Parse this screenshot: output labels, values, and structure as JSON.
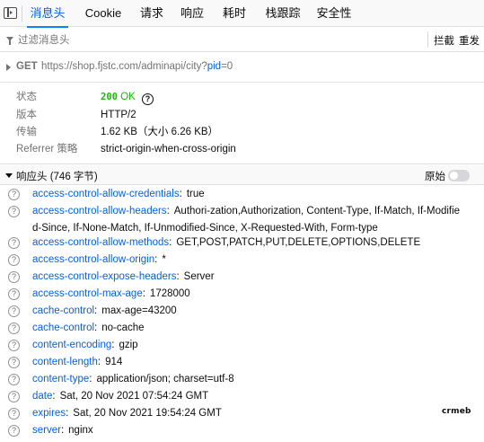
{
  "tabs": [
    {
      "label": "消息头",
      "active": true
    },
    {
      "label": "Cookie",
      "active": false
    },
    {
      "label": "请求",
      "active": false
    },
    {
      "label": "响应",
      "active": false
    },
    {
      "label": "耗时",
      "active": false
    },
    {
      "label": "栈跟踪",
      "active": false
    },
    {
      "label": "安全性",
      "active": false
    }
  ],
  "filter": {
    "placeholder": "过滤消息头",
    "block_label": "拦截",
    "resend_label": "重发"
  },
  "request": {
    "method": "GET",
    "url_base": "https://shop.fjstc.com/adminapi/city?",
    "url_param_key": "pid",
    "url_param_eq": "=0"
  },
  "summary": {
    "status_label": "状态",
    "status_code": "200",
    "status_text": "OK",
    "version_label": "版本",
    "version_value": "HTTP/2",
    "transfer_label": "传输",
    "transfer_value": "1.62 KB（大小 6.26 KB）",
    "referrer_label": "Referrer 策略",
    "referrer_value": "strict-origin-when-cross-origin"
  },
  "response_headers": {
    "title": "响应头 (746 字节)",
    "raw_label": "原始",
    "raw_enabled": false,
    "items": [
      {
        "name": "access-control-allow-credentials",
        "value": "true"
      },
      {
        "name": "access-control-allow-headers",
        "value": "Authori-zation,Authorization, Content-Type, If-Match, If-Modified-Since, If-None-Match, If-Unmodified-Since, X-Requested-With, Form-type"
      },
      {
        "name": "access-control-allow-methods",
        "value": "GET,POST,PATCH,PUT,DELETE,OPTIONS,DELETE"
      },
      {
        "name": "access-control-allow-origin",
        "value": "*"
      },
      {
        "name": "access-control-expose-headers",
        "value": "Server"
      },
      {
        "name": "access-control-max-age",
        "value": "1728000"
      },
      {
        "name": "cache-control",
        "value": "max-age=43200"
      },
      {
        "name": "cache-control",
        "value": "no-cache"
      },
      {
        "name": "content-encoding",
        "value": "gzip"
      },
      {
        "name": "content-length",
        "value": "914"
      },
      {
        "name": "content-type",
        "value": "application/json; charset=utf-8"
      },
      {
        "name": "date",
        "value": "Sat, 20 Nov 2021 07:54:24 GMT"
      },
      {
        "name": "expires",
        "value": "Sat, 20 Nov 2021 19:54:24 GMT"
      },
      {
        "name": "server",
        "value": "nginx"
      }
    ]
  },
  "watermark": "crmeb",
  "icons": {
    "panel_toggle": "sidebar-toggle-icon",
    "filter": "funnel-icon",
    "expand": "triangle-right-icon",
    "collapse": "triangle-down-icon",
    "help": "question-circle-icon"
  },
  "colors": {
    "accent": "#0060df",
    "status_ok": "#12bc00",
    "muted": "#737373"
  }
}
